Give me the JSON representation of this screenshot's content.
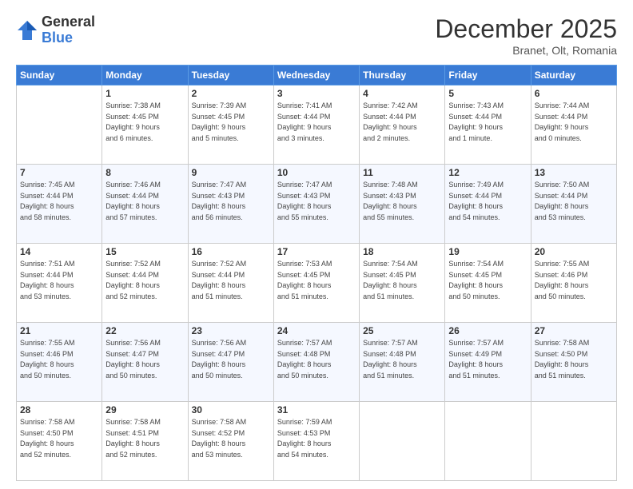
{
  "header": {
    "logo_general": "General",
    "logo_blue": "Blue",
    "month_title": "December 2025",
    "subtitle": "Branet, Olt, Romania"
  },
  "days_of_week": [
    "Sunday",
    "Monday",
    "Tuesday",
    "Wednesday",
    "Thursday",
    "Friday",
    "Saturday"
  ],
  "weeks": [
    [
      {
        "day": "",
        "info": ""
      },
      {
        "day": "1",
        "info": "Sunrise: 7:38 AM\nSunset: 4:45 PM\nDaylight: 9 hours\nand 6 minutes."
      },
      {
        "day": "2",
        "info": "Sunrise: 7:39 AM\nSunset: 4:45 PM\nDaylight: 9 hours\nand 5 minutes."
      },
      {
        "day": "3",
        "info": "Sunrise: 7:41 AM\nSunset: 4:44 PM\nDaylight: 9 hours\nand 3 minutes."
      },
      {
        "day": "4",
        "info": "Sunrise: 7:42 AM\nSunset: 4:44 PM\nDaylight: 9 hours\nand 2 minutes."
      },
      {
        "day": "5",
        "info": "Sunrise: 7:43 AM\nSunset: 4:44 PM\nDaylight: 9 hours\nand 1 minute."
      },
      {
        "day": "6",
        "info": "Sunrise: 7:44 AM\nSunset: 4:44 PM\nDaylight: 9 hours\nand 0 minutes."
      }
    ],
    [
      {
        "day": "7",
        "info": "Sunrise: 7:45 AM\nSunset: 4:44 PM\nDaylight: 8 hours\nand 58 minutes."
      },
      {
        "day": "8",
        "info": "Sunrise: 7:46 AM\nSunset: 4:44 PM\nDaylight: 8 hours\nand 57 minutes."
      },
      {
        "day": "9",
        "info": "Sunrise: 7:47 AM\nSunset: 4:43 PM\nDaylight: 8 hours\nand 56 minutes."
      },
      {
        "day": "10",
        "info": "Sunrise: 7:47 AM\nSunset: 4:43 PM\nDaylight: 8 hours\nand 55 minutes."
      },
      {
        "day": "11",
        "info": "Sunrise: 7:48 AM\nSunset: 4:43 PM\nDaylight: 8 hours\nand 55 minutes."
      },
      {
        "day": "12",
        "info": "Sunrise: 7:49 AM\nSunset: 4:44 PM\nDaylight: 8 hours\nand 54 minutes."
      },
      {
        "day": "13",
        "info": "Sunrise: 7:50 AM\nSunset: 4:44 PM\nDaylight: 8 hours\nand 53 minutes."
      }
    ],
    [
      {
        "day": "14",
        "info": "Sunrise: 7:51 AM\nSunset: 4:44 PM\nDaylight: 8 hours\nand 53 minutes."
      },
      {
        "day": "15",
        "info": "Sunrise: 7:52 AM\nSunset: 4:44 PM\nDaylight: 8 hours\nand 52 minutes."
      },
      {
        "day": "16",
        "info": "Sunrise: 7:52 AM\nSunset: 4:44 PM\nDaylight: 8 hours\nand 51 minutes."
      },
      {
        "day": "17",
        "info": "Sunrise: 7:53 AM\nSunset: 4:45 PM\nDaylight: 8 hours\nand 51 minutes."
      },
      {
        "day": "18",
        "info": "Sunrise: 7:54 AM\nSunset: 4:45 PM\nDaylight: 8 hours\nand 51 minutes."
      },
      {
        "day": "19",
        "info": "Sunrise: 7:54 AM\nSunset: 4:45 PM\nDaylight: 8 hours\nand 50 minutes."
      },
      {
        "day": "20",
        "info": "Sunrise: 7:55 AM\nSunset: 4:46 PM\nDaylight: 8 hours\nand 50 minutes."
      }
    ],
    [
      {
        "day": "21",
        "info": "Sunrise: 7:55 AM\nSunset: 4:46 PM\nDaylight: 8 hours\nand 50 minutes."
      },
      {
        "day": "22",
        "info": "Sunrise: 7:56 AM\nSunset: 4:47 PM\nDaylight: 8 hours\nand 50 minutes."
      },
      {
        "day": "23",
        "info": "Sunrise: 7:56 AM\nSunset: 4:47 PM\nDaylight: 8 hours\nand 50 minutes."
      },
      {
        "day": "24",
        "info": "Sunrise: 7:57 AM\nSunset: 4:48 PM\nDaylight: 8 hours\nand 50 minutes."
      },
      {
        "day": "25",
        "info": "Sunrise: 7:57 AM\nSunset: 4:48 PM\nDaylight: 8 hours\nand 51 minutes."
      },
      {
        "day": "26",
        "info": "Sunrise: 7:57 AM\nSunset: 4:49 PM\nDaylight: 8 hours\nand 51 minutes."
      },
      {
        "day": "27",
        "info": "Sunrise: 7:58 AM\nSunset: 4:50 PM\nDaylight: 8 hours\nand 51 minutes."
      }
    ],
    [
      {
        "day": "28",
        "info": "Sunrise: 7:58 AM\nSunset: 4:50 PM\nDaylight: 8 hours\nand 52 minutes."
      },
      {
        "day": "29",
        "info": "Sunrise: 7:58 AM\nSunset: 4:51 PM\nDaylight: 8 hours\nand 52 minutes."
      },
      {
        "day": "30",
        "info": "Sunrise: 7:58 AM\nSunset: 4:52 PM\nDaylight: 8 hours\nand 53 minutes."
      },
      {
        "day": "31",
        "info": "Sunrise: 7:59 AM\nSunset: 4:53 PM\nDaylight: 8 hours\nand 54 minutes."
      },
      {
        "day": "",
        "info": ""
      },
      {
        "day": "",
        "info": ""
      },
      {
        "day": "",
        "info": ""
      }
    ]
  ]
}
